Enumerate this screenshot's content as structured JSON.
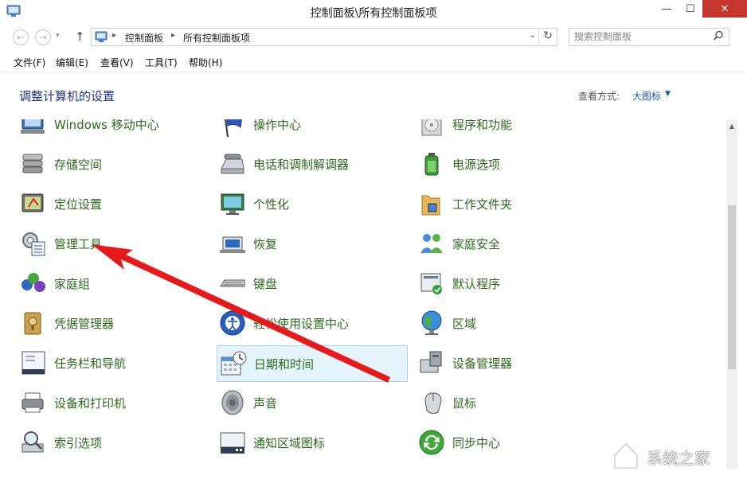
{
  "window": {
    "title": "控制面板\\所有控制面板项"
  },
  "window_controls": {
    "minimize": "—",
    "maximize": "☐",
    "close": "✕"
  },
  "nav": {
    "back": "←",
    "forward": "→",
    "recent": "▾",
    "up": "↑",
    "breadcrumbs": [
      "控制面板",
      "所有控制面板项"
    ],
    "separator": "▸",
    "dropdown": "⌄",
    "refresh": "↻"
  },
  "search": {
    "placeholder": "搜索控制面板"
  },
  "menu": [
    "文件(F)",
    "编辑(E)",
    "查看(V)",
    "工具(T)",
    "帮助(H)"
  ],
  "header": {
    "title": "调整计算机的设置",
    "view_by_label": "查看方式:",
    "view_by_value": "大图标",
    "view_by_arrow": "▼"
  },
  "items": [
    {
      "label": "Windows 移动中心",
      "icon": "mobility-center-icon"
    },
    {
      "label": "操作中心",
      "icon": "action-center-flag-icon"
    },
    {
      "label": "程序和功能",
      "icon": "programs-features-icon"
    },
    {
      "label": "存储空间",
      "icon": "storage-spaces-icon"
    },
    {
      "label": "电话和调制解调器",
      "icon": "phone-modem-icon"
    },
    {
      "label": "电源选项",
      "icon": "power-options-icon"
    },
    {
      "label": "定位设置",
      "icon": "location-settings-icon"
    },
    {
      "label": "个性化",
      "icon": "personalization-icon"
    },
    {
      "label": "工作文件夹",
      "icon": "work-folders-icon"
    },
    {
      "label": "管理工具",
      "icon": "admin-tools-icon"
    },
    {
      "label": "恢复",
      "icon": "recovery-icon"
    },
    {
      "label": "家庭安全",
      "icon": "family-safety-icon"
    },
    {
      "label": "家庭组",
      "icon": "homegroup-icon"
    },
    {
      "label": "键盘",
      "icon": "keyboard-icon"
    },
    {
      "label": "默认程序",
      "icon": "default-programs-icon"
    },
    {
      "label": "凭据管理器",
      "icon": "credential-manager-icon"
    },
    {
      "label": "轻松使用设置中心",
      "icon": "ease-of-access-icon"
    },
    {
      "label": "区域",
      "icon": "region-globe-icon"
    },
    {
      "label": "任务栏和导航",
      "icon": "taskbar-navigation-icon"
    },
    {
      "label": "日期和时间",
      "icon": "date-time-icon",
      "selected": true
    },
    {
      "label": "设备管理器",
      "icon": "device-manager-icon"
    },
    {
      "label": "设备和打印机",
      "icon": "devices-printers-icon"
    },
    {
      "label": "声音",
      "icon": "sound-speaker-icon"
    },
    {
      "label": "鼠标",
      "icon": "mouse-icon"
    },
    {
      "label": "索引选项",
      "icon": "indexing-options-icon"
    },
    {
      "label": "通知区域图标",
      "icon": "notification-area-icon"
    },
    {
      "label": "同步中心",
      "icon": "sync-center-icon"
    }
  ],
  "scrollbar": {
    "up": "▲"
  },
  "watermark": {
    "text": "系统之家"
  },
  "colors": {
    "link_green": "#2b6c1c",
    "accent_blue": "#1a58b8",
    "close_red": "#c7352f",
    "arrow_red": "#e8191a"
  }
}
